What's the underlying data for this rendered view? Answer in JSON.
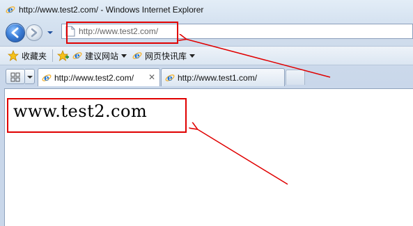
{
  "window": {
    "title": "http://www.test2.com/ - Windows Internet Explorer"
  },
  "navigation": {
    "address_url": "http://www.test2.com/"
  },
  "favorites_bar": {
    "favorites_label": "收藏夹",
    "suggested_sites_label": "建议网站",
    "web_slice_gallery_label": "网页快讯库"
  },
  "tabs": [
    {
      "label": "http://www.test2.com/",
      "active": true
    },
    {
      "label": "http://www.test1.com/",
      "active": false
    }
  ],
  "content": {
    "page_text": "www.test2.com"
  },
  "colors": {
    "annotation_red": "#e00000",
    "ie_blue": "#1e73d2",
    "ie_orange": "#f2b233"
  },
  "icons": [
    "ie-logo-icon",
    "back-arrow-icon",
    "forward-arrow-icon",
    "dropdown-arrow-icon",
    "page-icon",
    "favorites-star-icon",
    "add-favorites-icon",
    "quick-tabs-icon",
    "tab-list-icon",
    "close-tab-icon",
    "new-tab-icon"
  ]
}
